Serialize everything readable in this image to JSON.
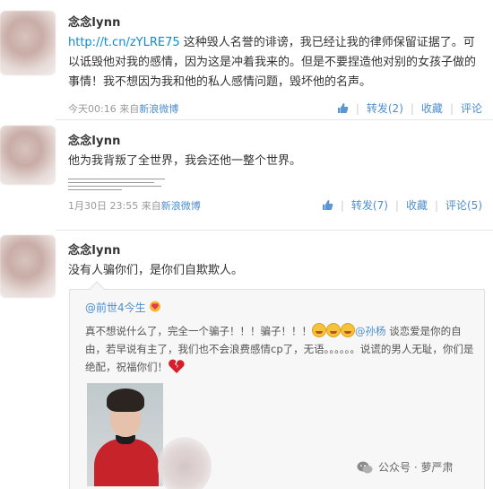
{
  "posts": [
    {
      "username": "念念lynn",
      "link": "http://t.cn/zYLRE75",
      "text": " 这种毁人名誉的诽谤，我已经让我的律师保留证据了。可以诋毁他对我的感情，因为这是冲着我来的。但是不要捏造他对别的女孩子做的事情！我不想因为我和他的私人感情问题，毁坏他的名声。",
      "time": "今天00:16",
      "source_prefix": "来自",
      "source": "新浪微博",
      "repost": "转发(2)",
      "favorite": "收藏",
      "comment": "评论"
    },
    {
      "username": "念念lynn",
      "text": "他为我背叛了全世界，我会还他一整个世界。",
      "time": "1月30日 23:55",
      "source_prefix": "来自",
      "source": "新浪微博",
      "repost": "转发(7)",
      "favorite": "收藏",
      "comment": "评论(5)"
    },
    {
      "username": "念念lynn",
      "text": "没有人骗你们，是你们自欺欺人。"
    }
  ],
  "quoted": {
    "user": "@前世4今生",
    "text_a": "真不想说什么了，完全一个骗子！！！骗子！！！",
    "mention": "@孙杨",
    "text_b": " 谈恋爱是你的自由，若早说有主了，我们也不会浪费感情cp了，无语。。。。。。说谎的男人无耻，你们是绝配，祝福你们！"
  },
  "watermark": "公众号 · 萝严肃",
  "colors": {
    "link": "#0a8cd2",
    "action": "#4e8ecf",
    "meta": "#999999"
  }
}
